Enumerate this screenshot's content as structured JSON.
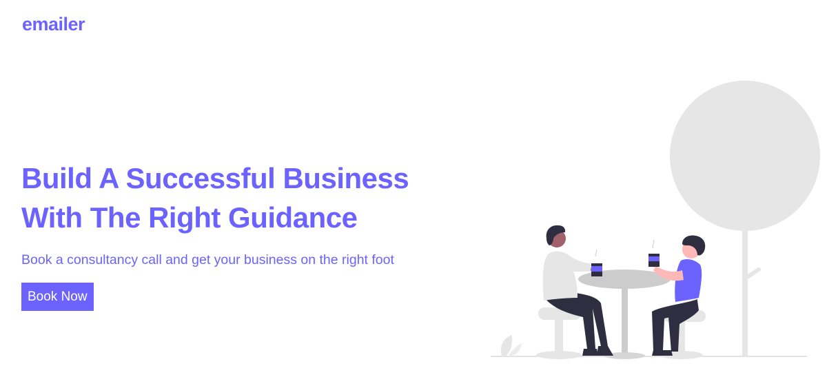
{
  "header": {
    "logo": "emailer"
  },
  "hero": {
    "headline_line1": "Build A Successful Business",
    "headline_line2": "With The Right Guidance",
    "subtitle": "Book a consultancy call and get your business on the right foot",
    "cta_label": "Book Now"
  },
  "theme": {
    "accent": "#6c63ff",
    "illustration_gray": "#e6e6e6",
    "illustration_dark": "#2f2e41",
    "skin_light": "#ffb8b8",
    "skin_dark": "#a0616a"
  }
}
